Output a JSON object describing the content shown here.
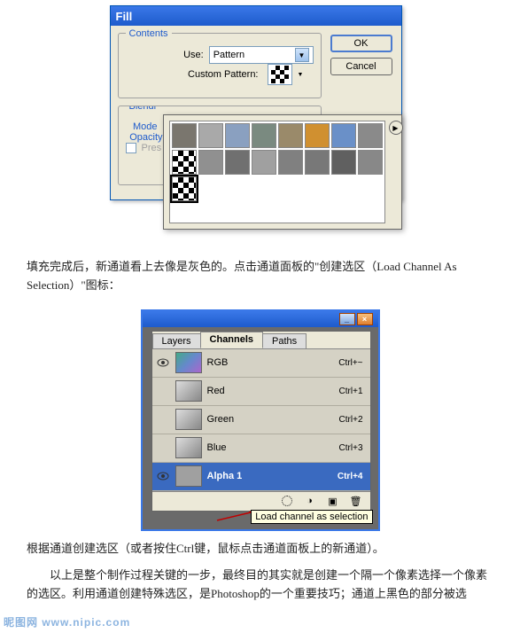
{
  "fill_dialog": {
    "title": "Fill",
    "contents_legend": "Contents",
    "use_label": "Use:",
    "use_value": "Pattern",
    "custom_pattern_label": "Custom Pattern:",
    "blending_legend": "Blending",
    "mode_label": "Mode:",
    "opacity_label": "Opacity:",
    "preserve_label": "Preserve Transparency",
    "ok_label": "OK",
    "cancel_label": "Cancel"
  },
  "pattern_popup": {
    "patterns": [
      {
        "fill": "#7a766e"
      },
      {
        "fill": "#a9a9a9"
      },
      {
        "fill": "#8aa0c0"
      },
      {
        "fill": "#7a8a80"
      },
      {
        "fill": "#9a8a6a"
      },
      {
        "fill": "#d09030"
      },
      {
        "fill": "#6a90c8"
      },
      {
        "fill": "#8a8a8a"
      },
      {
        "fill": "checker"
      },
      {
        "fill": "#909090"
      },
      {
        "fill": "#707070"
      },
      {
        "fill": "#a0a0a0"
      },
      {
        "fill": "#808080"
      },
      {
        "fill": "#787878"
      },
      {
        "fill": "#606060"
      },
      {
        "fill": "#888888"
      },
      {
        "fill": "checker",
        "selected": true
      }
    ]
  },
  "text_block_1": "填充完成后，新通道看上去像是灰色的。点击通道面板的\"创建选区（Load Channel As Selection）\"图标：",
  "channels_panel": {
    "tabs": {
      "layers": "Layers",
      "channels": "Channels",
      "paths": "Paths",
      "active": "channels"
    },
    "rows": [
      {
        "visible": true,
        "name": "RGB",
        "shortcut": "Ctrl+~",
        "thumb": "rgb"
      },
      {
        "visible": false,
        "name": "Red",
        "shortcut": "Ctrl+1",
        "thumb": "gray"
      },
      {
        "visible": false,
        "name": "Green",
        "shortcut": "Ctrl+2",
        "thumb": "gray"
      },
      {
        "visible": false,
        "name": "Blue",
        "shortcut": "Ctrl+3",
        "thumb": "gray"
      },
      {
        "visible": true,
        "name": "Alpha 1",
        "shortcut": "Ctrl+4",
        "thumb": "alpha",
        "selected": true
      }
    ],
    "bottom_icons": [
      "load-selection",
      "save-selection",
      "new-channel",
      "delete-channel"
    ],
    "tooltip": "Load channel as selection"
  },
  "text_block_2": "根据通道创建选区（或者按住Ctrl键，鼠标点击通道面板上的新通道）。",
  "text_block_3": "　　以上是整个制作过程关键的一步，最终目的其实就是创建一个隔一个像素选择一个像素的选区。利用通道创建特殊选区，是Photoshop的一个重要技巧；通道上黑色的部分被选",
  "watermark": "昵图网 www.nipic.com"
}
